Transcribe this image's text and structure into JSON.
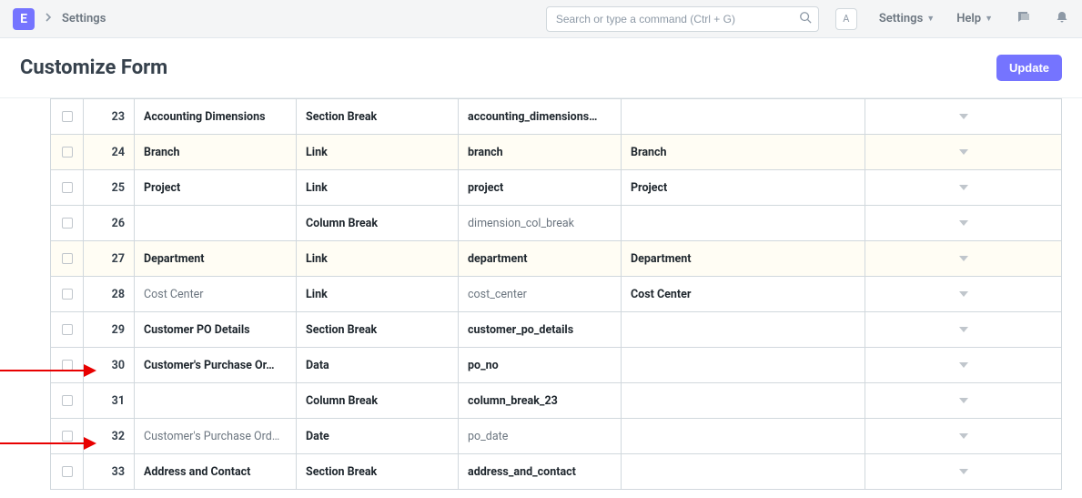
{
  "nav": {
    "logo_letter": "E",
    "breadcrumb": "Settings",
    "search_placeholder": "Search or type a command (Ctrl + G)",
    "avatar_initial": "A",
    "settings_label": "Settings",
    "help_label": "Help"
  },
  "header": {
    "title": "Customize Form",
    "update_label": "Update"
  },
  "rows": [
    {
      "idx": "23",
      "label": "Accounting Dimensions",
      "type": "Section Break",
      "name": "accounting_dimensions…",
      "options": "",
      "highlight": false,
      "muted": false
    },
    {
      "idx": "24",
      "label": "Branch",
      "type": "Link",
      "name": "branch",
      "options": "Branch",
      "highlight": true,
      "muted": false
    },
    {
      "idx": "25",
      "label": "Project",
      "type": "Link",
      "name": "project",
      "options": "Project",
      "highlight": false,
      "muted": false
    },
    {
      "idx": "26",
      "label": "",
      "type": "Column Break",
      "name": "dimension_col_break",
      "options": "",
      "highlight": false,
      "muted": true
    },
    {
      "idx": "27",
      "label": "Department",
      "type": "Link",
      "name": "department",
      "options": "Department",
      "highlight": true,
      "muted": false
    },
    {
      "idx": "28",
      "label": "Cost Center",
      "type": "Link",
      "name": "cost_center",
      "options": "Cost Center",
      "highlight": false,
      "muted": true
    },
    {
      "idx": "29",
      "label": "Customer PO Details",
      "type": "Section Break",
      "name": "customer_po_details",
      "options": "",
      "highlight": false,
      "muted": false
    },
    {
      "idx": "30",
      "label": "Customer's Purchase Or…",
      "type": "Data",
      "name": "po_no",
      "options": "",
      "highlight": false,
      "muted": false
    },
    {
      "idx": "31",
      "label": "",
      "type": "Column Break",
      "name": "column_break_23",
      "options": "",
      "highlight": false,
      "muted": false
    },
    {
      "idx": "32",
      "label": "Customer's Purchase Ord…",
      "type": "Date",
      "name": "po_date",
      "options": "",
      "highlight": false,
      "muted": true
    },
    {
      "idx": "33",
      "label": "Address and Contact",
      "type": "Section Break",
      "name": "address_and_contact",
      "options": "",
      "highlight": false,
      "muted": false
    }
  ]
}
